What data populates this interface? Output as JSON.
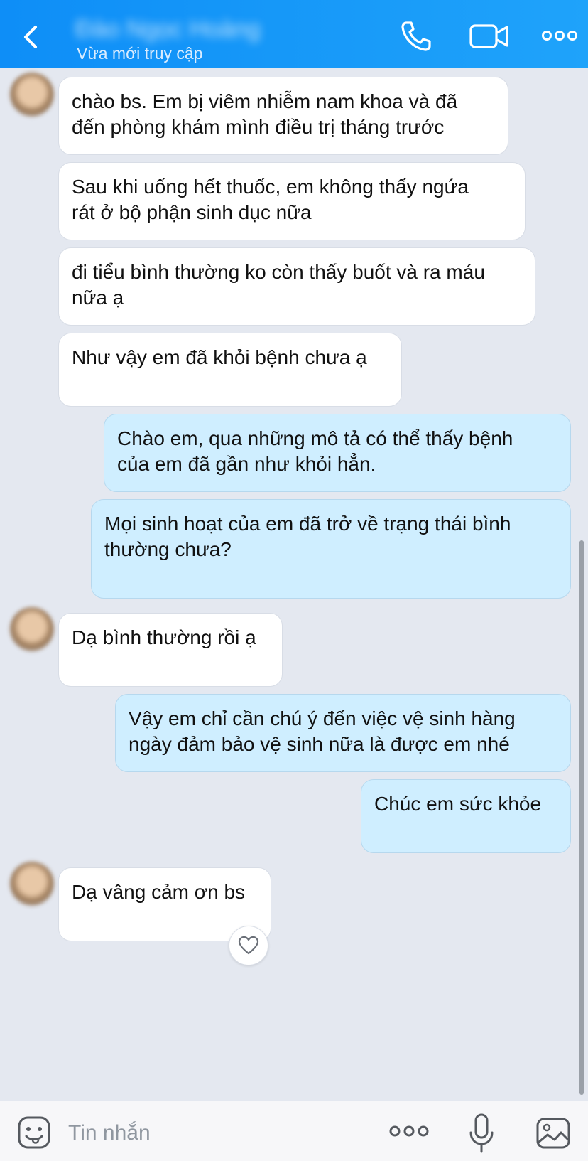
{
  "header": {
    "contact_name": "Đào Ngọc Hoàng",
    "status": "Vừa mới truy cập",
    "icons": [
      "back-icon",
      "phone-icon",
      "video-call-icon",
      "more-icon"
    ]
  },
  "messages": [
    {
      "side": "in",
      "text": "chào bs. Em bị viêm nhiễm nam khoa và đã\nđến phòng khám mình điều trị tháng trước"
    },
    {
      "side": "in",
      "text": "Sau khi uống hết thuốc, em không thấy ngứa\nrát ở bộ phận sinh dục nữa"
    },
    {
      "side": "in",
      "text": "đi tiểu bình thường ko còn thấy buốt và ra máu\nnữa ạ"
    },
    {
      "side": "in",
      "text": "Như vậy em đã khỏi bệnh chưa ạ"
    },
    {
      "side": "out",
      "text": "Chào em, qua những mô tả có thể thấy bệnh\ncủa em đã gần như khỏi hẳn."
    },
    {
      "side": "out",
      "text": "Mọi sinh hoạt của em đã trở về trạng thái bình\nthường chưa?"
    },
    {
      "side": "in",
      "text": "Dạ bình thường rồi ạ"
    },
    {
      "side": "out",
      "text": "Vậy em chỉ cần chú ý đến việc vệ sinh hàng\nngày đảm bảo vệ sinh nữa là được em nhé"
    },
    {
      "side": "out",
      "text": "Chúc em sức khỏe"
    },
    {
      "side": "in",
      "text": "Dạ vâng cảm ơn bs"
    }
  ],
  "composer": {
    "placeholder": "Tin nhắn",
    "icons": [
      "emoji-icon",
      "more-icon",
      "microphone-icon",
      "image-icon"
    ]
  },
  "colors": {
    "header": "#1a9bf8",
    "background": "#e4e8f0",
    "incoming_bubble": "#ffffff",
    "outgoing_bubble": "#cfeeff"
  }
}
